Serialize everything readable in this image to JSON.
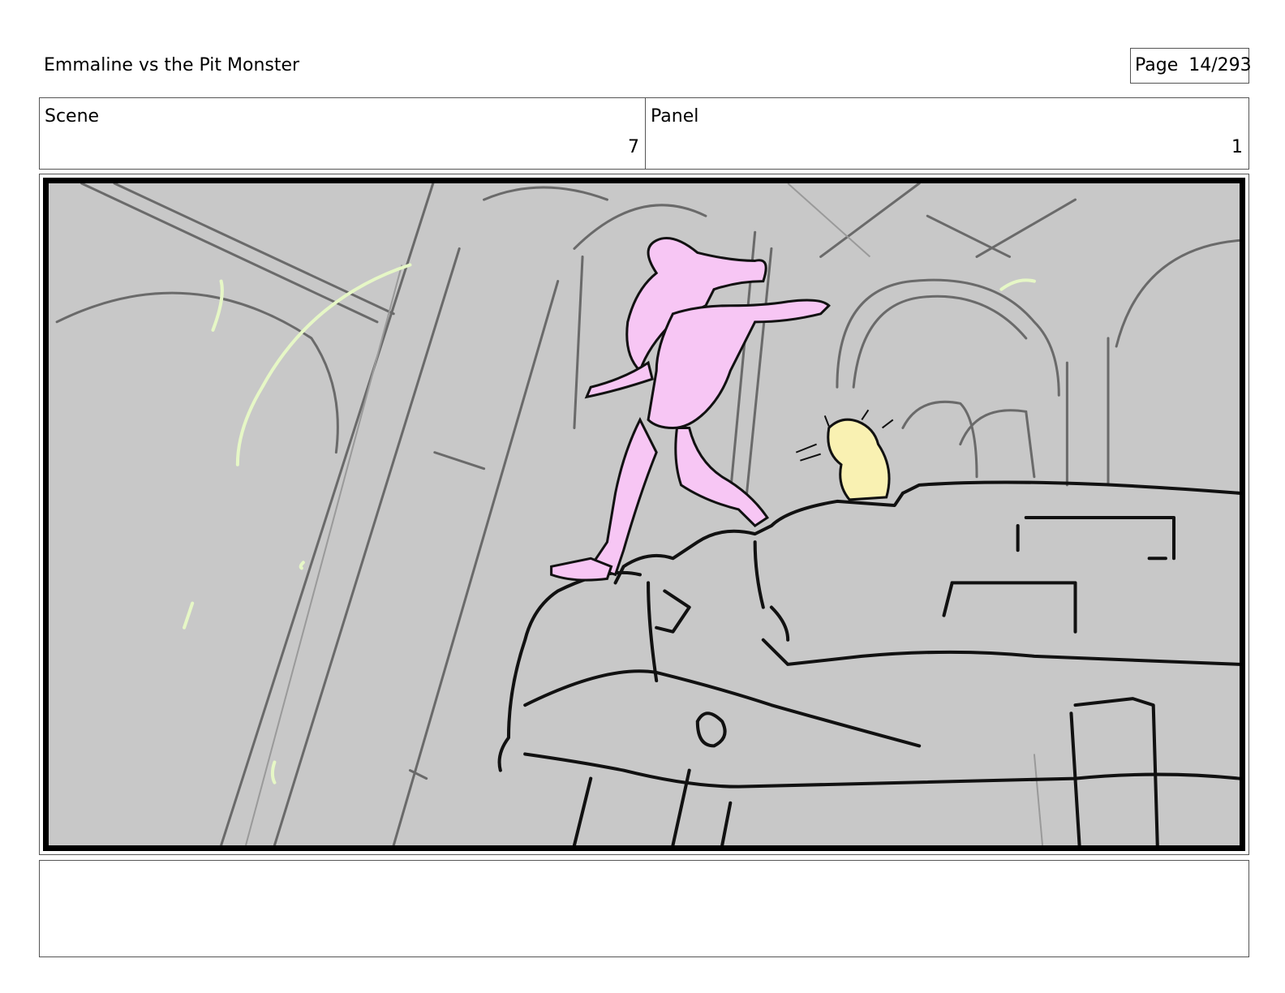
{
  "document": {
    "title": "Emmaline vs the Pit Monster",
    "page_label": "Page",
    "page_number": "14/293"
  },
  "header": {
    "scene_label": "Scene",
    "scene_value": "7",
    "panel_label": "Panel",
    "panel_value": "1"
  },
  "panel_image": {
    "background_color": "#c8c8c8",
    "character_color": "#f7c6f4",
    "creature_color": "#f9f1b2",
    "effect_color": "#e6f7c6"
  },
  "notes": {
    "text": ""
  }
}
